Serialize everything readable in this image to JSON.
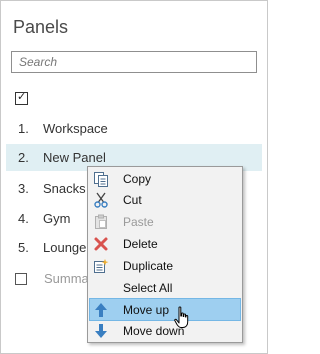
{
  "panel": {
    "title": "Panels",
    "search_placeholder": "Search",
    "select_all_checked": true,
    "items": [
      {
        "number": "1.",
        "label": "Workspace",
        "selected": false
      },
      {
        "number": "2.",
        "label": "New Panel",
        "selected": true
      },
      {
        "number": "3.",
        "label": "Snacks and drinks",
        "selected": false
      },
      {
        "number": "4.",
        "label": "Gym",
        "selected": false
      },
      {
        "number": "5.",
        "label": "Lounge",
        "selected": false
      }
    ],
    "summary_label": "Summary"
  },
  "context_menu": {
    "items": [
      {
        "label": "Copy",
        "icon": "copy-icon",
        "enabled": true
      },
      {
        "label": "Cut",
        "icon": "scissors-icon",
        "enabled": true
      },
      {
        "label": "Paste",
        "icon": "clipboard-icon",
        "enabled": false
      },
      {
        "label": "Delete",
        "icon": "x-icon",
        "enabled": true
      },
      {
        "label": "Duplicate",
        "icon": "duplicate-icon",
        "enabled": true
      },
      {
        "label": "Select All",
        "icon": "",
        "enabled": true
      },
      {
        "label": "Move up",
        "icon": "arrow-up-icon",
        "enabled": true,
        "highlighted": true
      },
      {
        "label": "Move down",
        "icon": "arrow-down-icon",
        "enabled": true
      }
    ]
  },
  "colors": {
    "selection": "#e0eff3",
    "menu_highlight": "#9ecff0",
    "arrow_blue": "#3a7fc1",
    "delete_red": "#d9534f"
  }
}
